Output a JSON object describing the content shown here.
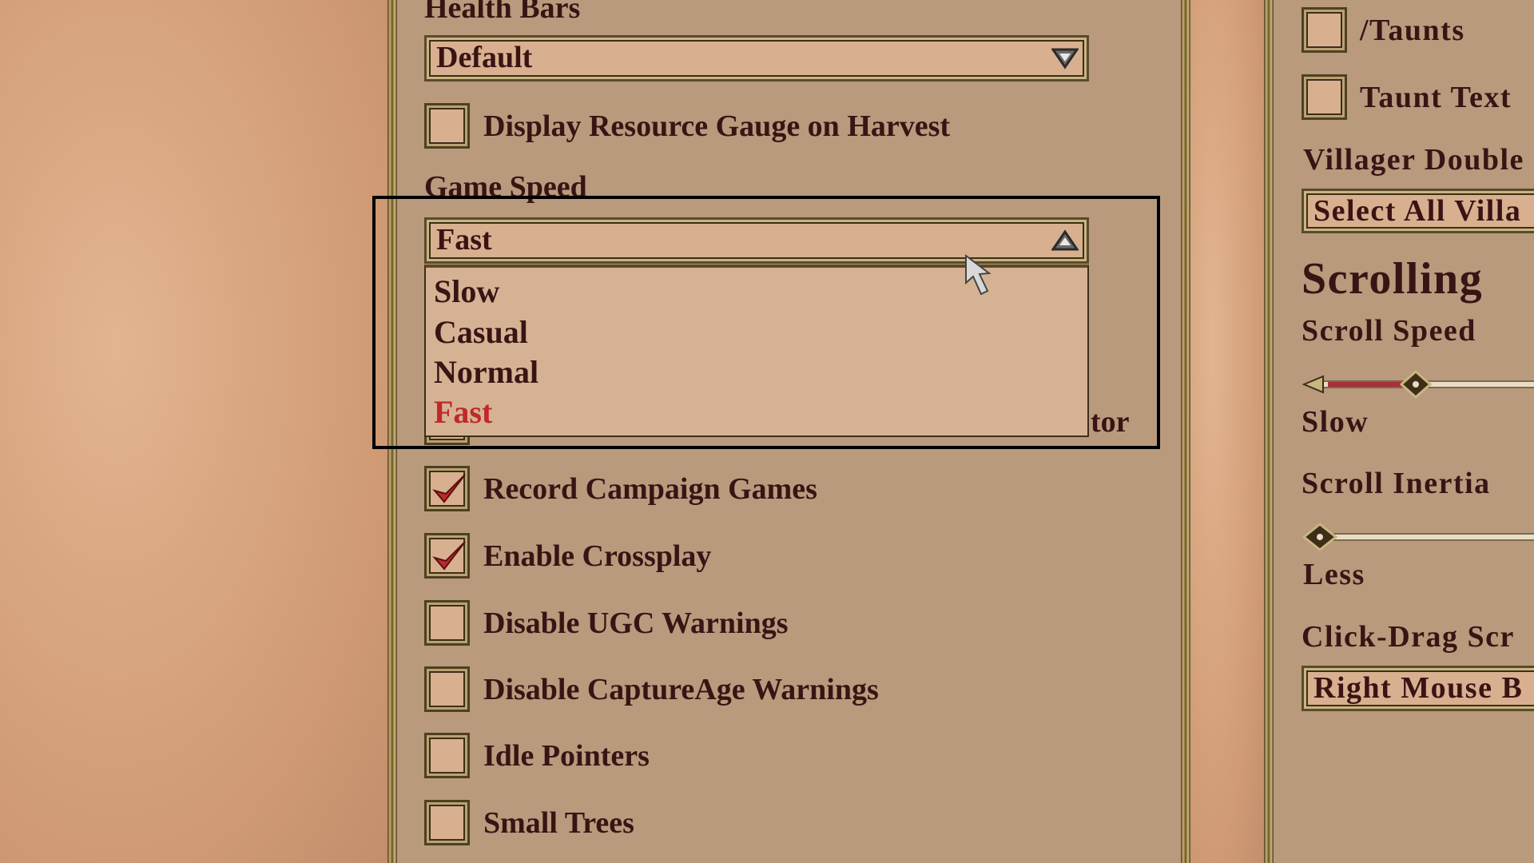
{
  "left_panel": {
    "health_bars": {
      "label": "Health Bars",
      "value": "Default"
    },
    "display_resource_gauge": {
      "label": "Display Resource Gauge on Harvest",
      "checked": false
    },
    "game_speed": {
      "label": "Game Speed",
      "value": "Fast",
      "expanded": true,
      "options": [
        "Slow",
        "Casual",
        "Normal",
        "Fast"
      ],
      "selected_color": "#c0282a"
    },
    "hidden_item_suffix": "tor",
    "checkboxes": [
      {
        "label": "Record Campaign Games",
        "checked": true
      },
      {
        "label": "Enable Crossplay",
        "checked": true
      },
      {
        "label": "Disable UGC Warnings",
        "checked": false
      },
      {
        "label": "Disable CaptureAge Warnings",
        "checked": false
      },
      {
        "label": "Idle Pointers",
        "checked": false
      },
      {
        "label": "Small Trees",
        "checked": false
      }
    ]
  },
  "right_panel": {
    "taunts": {
      "label": "/Taunts",
      "checked": false
    },
    "taunt_text": {
      "label": "Taunt Text",
      "checked": false
    },
    "villager_double": {
      "label": "Villager Double",
      "value": "Select All Villa"
    },
    "section_title": "Scrolling",
    "scroll_speed": {
      "label": "Scroll Speed",
      "min_label": "Slow",
      "fill_color": "#a8303a"
    },
    "scroll_inertia": {
      "label": "Scroll Inertia",
      "min_label": "Less"
    },
    "click_drag": {
      "label": "Click-Drag Scr",
      "value": "Right Mouse B"
    }
  }
}
